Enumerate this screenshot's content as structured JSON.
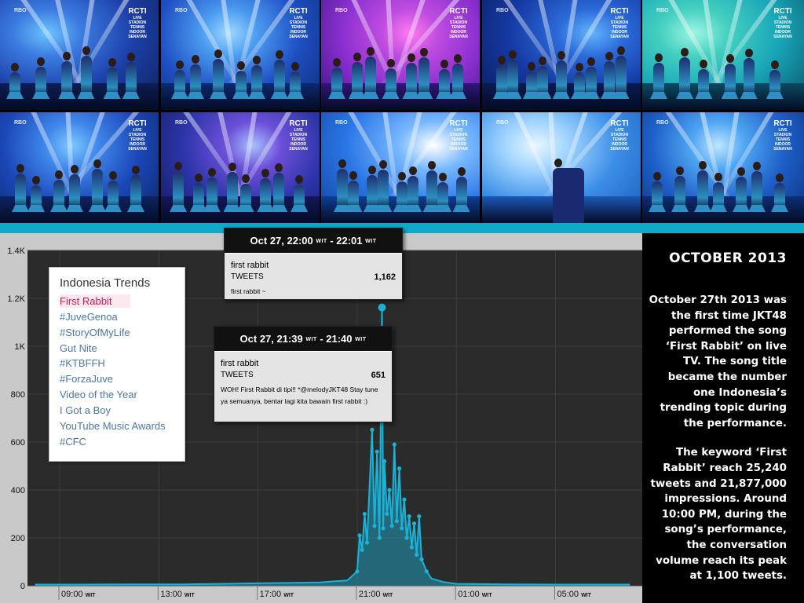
{
  "collage": {
    "channel_label": "RBO",
    "logo_top": "RCTI",
    "logo_sub": "LIVE",
    "logo_caption": "STADION TENNIS INDOOR SENAYAN"
  },
  "trends": {
    "title": "Indonesia Trends",
    "items": [
      "First Rabbit",
      "#JuveGenoa",
      "#StoryOfMyLife",
      "Gut Nite",
      "#KTBFFH",
      "#ForzaJuve",
      "Video of the Year",
      "I Got a Boy",
      "YouTube Music Awards",
      "#CFC"
    ]
  },
  "tooltips": {
    "peak": {
      "time_start": "Oct 27, 22:00",
      "time_end": "22:01",
      "tz": "WIT",
      "keyword": "first rabbit",
      "metric_label": "TWEETS",
      "count": "1,162",
      "quote": "first rabbit ~"
    },
    "first": {
      "time_start": "Oct 27, 21:39",
      "time_end": "21:40",
      "tz": "WIT",
      "keyword": "first rabbit",
      "metric_label": "TWEETS",
      "count": "651",
      "quote": "WOH! First Rabbit di tipi!! *@melodyJKT48 Stay tune ya semuanya, bentar lagi kita bawain first rabbit :)"
    }
  },
  "story": {
    "title": "OCTOBER 2013",
    "paragraph1": "October 27th 2013 was the first time JKT48 performed the song ‘First Rabbit’ on live TV. The song title became the number one Indonesia’s trending topic during the performance.",
    "paragraph2": "The keyword ‘First Rabbit’ reach 25,240 tweets and 21,877,000 impressions. Around 10:00 PM, during the song’s performance, the conversation volume reach its peak at 1,100 tweets."
  },
  "colors": {
    "accent": "#11a9c9",
    "line": "#1ab2d6",
    "plot_bg": "#2b2b2b",
    "panel_bg": "#c9c9c9",
    "trend_highlight": "#d0195a",
    "trend_link": "#4c77a6"
  },
  "chart_data": {
    "type": "line",
    "ylim": [
      0,
      1400
    ],
    "yticks": [
      "0",
      "200",
      "400",
      "600",
      "800",
      "1K",
      "1.2K",
      "1.4K"
    ],
    "xticks": [
      {
        "label": "09:00",
        "tz": "WIT"
      },
      {
        "label": "13:00",
        "tz": "WIT"
      },
      {
        "label": "17:00",
        "tz": "WIT"
      },
      {
        "label": "21:00",
        "tz": "WIT"
      },
      {
        "label": "01:00",
        "tz": "WIT"
      },
      {
        "label": "05:00",
        "tz": "WIT"
      }
    ],
    "x_unit": "hours",
    "series": [
      {
        "values": [
          [
            8.0,
            5
          ],
          [
            10.0,
            5
          ],
          [
            12.0,
            6
          ],
          [
            14.0,
            6
          ],
          [
            15.5,
            8
          ],
          [
            17.0,
            10
          ],
          [
            18.5,
            12
          ],
          [
            19.5,
            14
          ],
          [
            20.0,
            18
          ],
          [
            20.6,
            22
          ],
          [
            21.0,
            60
          ],
          [
            21.1,
            210
          ],
          [
            21.2,
            150
          ],
          [
            21.3,
            300
          ],
          [
            21.4,
            180
          ],
          [
            21.6,
            651
          ],
          [
            21.7,
            250
          ],
          [
            21.8,
            560
          ],
          [
            21.9,
            200
          ],
          [
            22.0,
            1162
          ],
          [
            22.05,
            240
          ],
          [
            22.1,
            520
          ],
          [
            22.2,
            300
          ],
          [
            22.3,
            400
          ],
          [
            22.4,
            250
          ],
          [
            22.5,
            590
          ],
          [
            22.6,
            270
          ],
          [
            22.7,
            490
          ],
          [
            22.8,
            240
          ],
          [
            22.9,
            360
          ],
          [
            23.0,
            200
          ],
          [
            23.1,
            290
          ],
          [
            23.2,
            160
          ],
          [
            23.3,
            260
          ],
          [
            23.4,
            130
          ],
          [
            23.5,
            290
          ],
          [
            23.6,
            110
          ],
          [
            23.8,
            60
          ],
          [
            24.0,
            30
          ],
          [
            24.5,
            15
          ],
          [
            25.0,
            8
          ],
          [
            27.0,
            6
          ],
          [
            29.0,
            5
          ],
          [
            31.0,
            5
          ],
          [
            32.0,
            5
          ]
        ]
      }
    ],
    "grid": true
  }
}
